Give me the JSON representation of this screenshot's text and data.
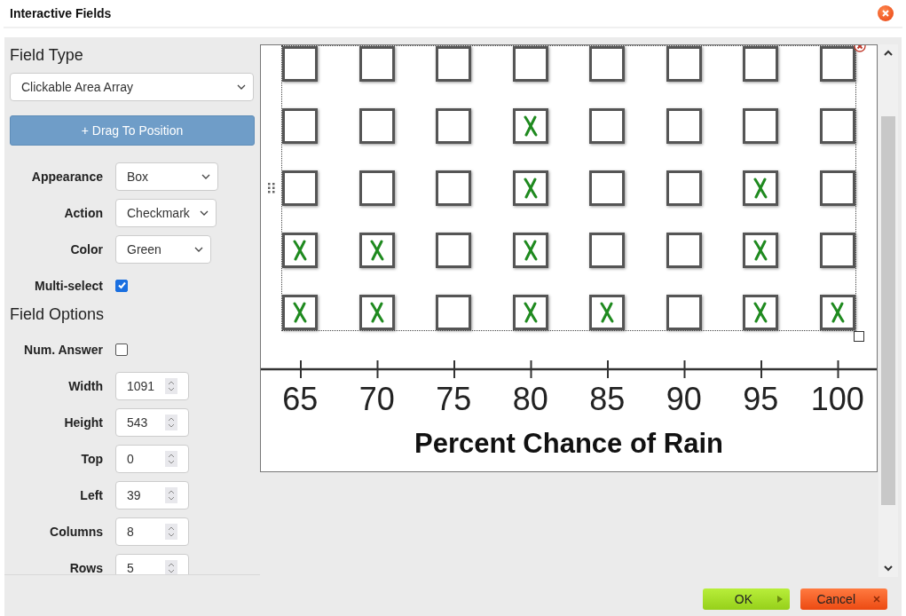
{
  "window": {
    "title": "Interactive Fields"
  },
  "field_type": {
    "heading": "Field Type",
    "value": "Clickable Area Array"
  },
  "drag_button": "+ Drag To Position",
  "settings": [
    {
      "kind": "select",
      "label": "Appearance",
      "value": "Box"
    },
    {
      "kind": "select",
      "label": "Action",
      "value": "Checkmark"
    },
    {
      "kind": "select",
      "label": "Color",
      "value": "Green"
    },
    {
      "kind": "checkbox",
      "label": "Multi-select",
      "checked": true
    }
  ],
  "options_heading": "Field Options",
  "options": [
    {
      "kind": "checkbox",
      "label": "Num. Answer",
      "checked": false
    },
    {
      "kind": "number",
      "label": "Width",
      "value": "1091"
    },
    {
      "kind": "number",
      "label": "Height",
      "value": "543"
    },
    {
      "kind": "number",
      "label": "Top",
      "value": "0"
    },
    {
      "kind": "number",
      "label": "Left",
      "value": "39"
    },
    {
      "kind": "number",
      "label": "Columns",
      "value": "8"
    },
    {
      "kind": "number",
      "label": "Rows",
      "value": "5"
    }
  ],
  "canvas": {
    "grid": [
      [
        {
          "checked": false
        },
        {
          "checked": false
        },
        {
          "checked": false
        },
        {
          "checked": false
        },
        {
          "checked": false
        },
        {
          "checked": false
        },
        {
          "checked": false
        },
        {
          "checked": false
        }
      ],
      [
        {
          "checked": false
        },
        {
          "checked": false
        },
        {
          "checked": false
        },
        {
          "checked": true
        },
        {
          "checked": false
        },
        {
          "checked": false
        },
        {
          "checked": false
        },
        {
          "checked": false
        }
      ],
      [
        {
          "checked": false
        },
        {
          "checked": false
        },
        {
          "checked": false
        },
        {
          "checked": true
        },
        {
          "checked": false
        },
        {
          "checked": false
        },
        {
          "checked": true
        },
        {
          "checked": false
        }
      ],
      [
        {
          "checked": true
        },
        {
          "checked": true
        },
        {
          "checked": false
        },
        {
          "checked": true
        },
        {
          "checked": false
        },
        {
          "checked": false
        },
        {
          "checked": true
        },
        {
          "checked": false
        }
      ],
      [
        {
          "checked": true
        },
        {
          "checked": true
        },
        {
          "checked": false
        },
        {
          "checked": true
        },
        {
          "checked": true
        },
        {
          "checked": false
        },
        {
          "checked": true
        },
        {
          "checked": true
        }
      ]
    ],
    "axis_labels": [
      "65",
      "70",
      "75",
      "80",
      "85",
      "90",
      "95",
      "100"
    ],
    "axis_title": "Percent Chance of Rain"
  },
  "buttons": [
    {
      "kind": "ok",
      "label": "OK"
    },
    {
      "kind": "cancel",
      "label": "Cancel"
    }
  ]
}
